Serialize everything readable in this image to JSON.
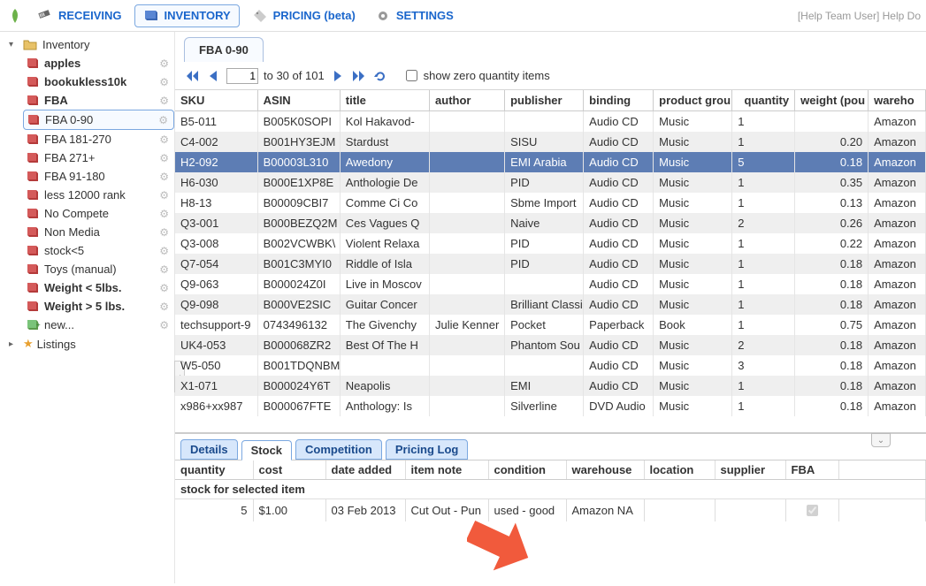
{
  "topnav": {
    "tabs": [
      {
        "label": "RECEIVING",
        "icon": "barcode"
      },
      {
        "label": "INVENTORY",
        "icon": "book"
      },
      {
        "label": "PRICING (beta)",
        "icon": "tag"
      },
      {
        "label": "SETTINGS",
        "icon": "gear"
      }
    ],
    "active_tab_index": 1,
    "help_text": "[Help Team User] Help Do"
  },
  "sidebar": {
    "root_label": "Inventory",
    "items": [
      {
        "label": "apples",
        "bold": true
      },
      {
        "label": "bookukless10k",
        "bold": true
      },
      {
        "label": "FBA",
        "bold": true
      },
      {
        "label": "FBA 0-90",
        "selected": true
      },
      {
        "label": "FBA 181-270"
      },
      {
        "label": "FBA 271+"
      },
      {
        "label": "FBA 91-180"
      },
      {
        "label": "less 12000 rank"
      },
      {
        "label": "No Compete"
      },
      {
        "label": "Non Media"
      },
      {
        "label": "stock<5"
      },
      {
        "label": "Toys (manual)"
      },
      {
        "label": "Weight < 5lbs.",
        "bold": true
      },
      {
        "label": "Weight > 5 lbs.",
        "bold": true
      },
      {
        "label": "new...",
        "new": true
      }
    ],
    "listings_label": "Listings"
  },
  "panel": {
    "title": "FBA 0-90",
    "pager": {
      "page_input": "1",
      "range_text": "to 30 of 101",
      "zero_checkbox_label": "show zero quantity items",
      "zero_checked": false
    },
    "columns": [
      "SKU",
      "ASIN",
      "title",
      "author",
      "publisher",
      "binding",
      "product grou",
      "quantity",
      "weight (pou",
      "wareho"
    ],
    "rows": [
      {
        "sku": "B5-011",
        "asin": "B005K0SOPI",
        "title": "Kol Hakavod-",
        "author": "",
        "publisher": "",
        "binding": "Audio CD",
        "group": "Music",
        "qty": "1",
        "weight": "",
        "wh": "Amazon"
      },
      {
        "sku": "C4-002",
        "asin": "B001HY3EJM",
        "title": "Stardust",
        "author": "",
        "publisher": "SISU",
        "binding": "Audio CD",
        "group": "Music",
        "qty": "1",
        "weight": "0.20",
        "wh": "Amazon"
      },
      {
        "sku": "H2-092",
        "asin": "B00003L310",
        "title": "Awedony",
        "author": "",
        "publisher": "EMI Arabia",
        "binding": "Audio CD",
        "group": "Music",
        "qty": "5",
        "weight": "0.18",
        "wh": "Amazon",
        "selected": true
      },
      {
        "sku": "H6-030",
        "asin": "B000E1XP8E",
        "title": "Anthologie De",
        "author": "",
        "publisher": "PID",
        "binding": "Audio CD",
        "group": "Music",
        "qty": "1",
        "weight": "0.35",
        "wh": "Amazon"
      },
      {
        "sku": "H8-13",
        "asin": "B00009CBI7",
        "title": "Comme Ci Co",
        "author": "",
        "publisher": "Sbme Import",
        "binding": "Audio CD",
        "group": "Music",
        "qty": "1",
        "weight": "0.13",
        "wh": "Amazon"
      },
      {
        "sku": "Q3-001",
        "asin": "B000BEZQ2M",
        "title": "Ces Vagues Q",
        "author": "",
        "publisher": "Naive",
        "binding": "Audio CD",
        "group": "Music",
        "qty": "2",
        "weight": "0.26",
        "wh": "Amazon"
      },
      {
        "sku": "Q3-008",
        "asin": "B002VCWBK\\",
        "title": "Violent Relaxa",
        "author": "",
        "publisher": "PID",
        "binding": "Audio CD",
        "group": "Music",
        "qty": "1",
        "weight": "0.22",
        "wh": "Amazon"
      },
      {
        "sku": "Q7-054",
        "asin": "B001C3MYI0",
        "title": "Riddle of Isla",
        "author": "",
        "publisher": "PID",
        "binding": "Audio CD",
        "group": "Music",
        "qty": "1",
        "weight": "0.18",
        "wh": "Amazon"
      },
      {
        "sku": "Q9-063",
        "asin": "B000024Z0I",
        "title": "Live in Moscov",
        "author": "",
        "publisher": "",
        "binding": "Audio CD",
        "group": "Music",
        "qty": "1",
        "weight": "0.18",
        "wh": "Amazon"
      },
      {
        "sku": "Q9-098",
        "asin": "B000VE2SIC",
        "title": "Guitar Concer",
        "author": "",
        "publisher": "Brilliant Classi",
        "binding": "Audio CD",
        "group": "Music",
        "qty": "1",
        "weight": "0.18",
        "wh": "Amazon"
      },
      {
        "sku": "techsupport-9",
        "asin": "0743496132",
        "title": "The Givenchy",
        "author": "Julie Kenner",
        "publisher": "Pocket",
        "binding": "Paperback",
        "group": "Book",
        "qty": "1",
        "weight": "0.75",
        "wh": "Amazon"
      },
      {
        "sku": "UK4-053",
        "asin": "B000068ZR2",
        "title": "Best Of The H",
        "author": "",
        "publisher": "Phantom Sou",
        "binding": "Audio CD",
        "group": "Music",
        "qty": "2",
        "weight": "0.18",
        "wh": "Amazon"
      },
      {
        "sku": "W5-050",
        "asin": "B001TDQNBM",
        "title": "",
        "author": "",
        "publisher": "",
        "binding": "Audio CD",
        "group": "Music",
        "qty": "3",
        "weight": "0.18",
        "wh": "Amazon"
      },
      {
        "sku": "X1-071",
        "asin": "B000024Y6T",
        "title": "Neapolis",
        "author": "",
        "publisher": "EMI",
        "binding": "Audio CD",
        "group": "Music",
        "qty": "1",
        "weight": "0.18",
        "wh": "Amazon"
      },
      {
        "sku": "x986+xx987",
        "asin": "B000067FTE",
        "title": "Anthology: Is",
        "author": "",
        "publisher": "Silverline",
        "binding": "DVD Audio",
        "group": "Music",
        "qty": "1",
        "weight": "0.18",
        "wh": "Amazon"
      }
    ],
    "detail_tabs": [
      "Details",
      "Stock",
      "Competition",
      "Pricing Log"
    ],
    "detail_active_index": 1,
    "stock": {
      "columns": [
        "quantity",
        "cost",
        "date added",
        "item note",
        "condition",
        "warehouse",
        "location",
        "supplier",
        "FBA"
      ],
      "subhead": "stock for selected item",
      "row": {
        "qty": "5",
        "cost": "$1.00",
        "date": "03 Feb 2013",
        "note": "Cut Out - Pun",
        "cond": "used - good",
        "wh": "Amazon NA",
        "loc": "",
        "supplier": "",
        "fba_checked": true
      }
    }
  }
}
